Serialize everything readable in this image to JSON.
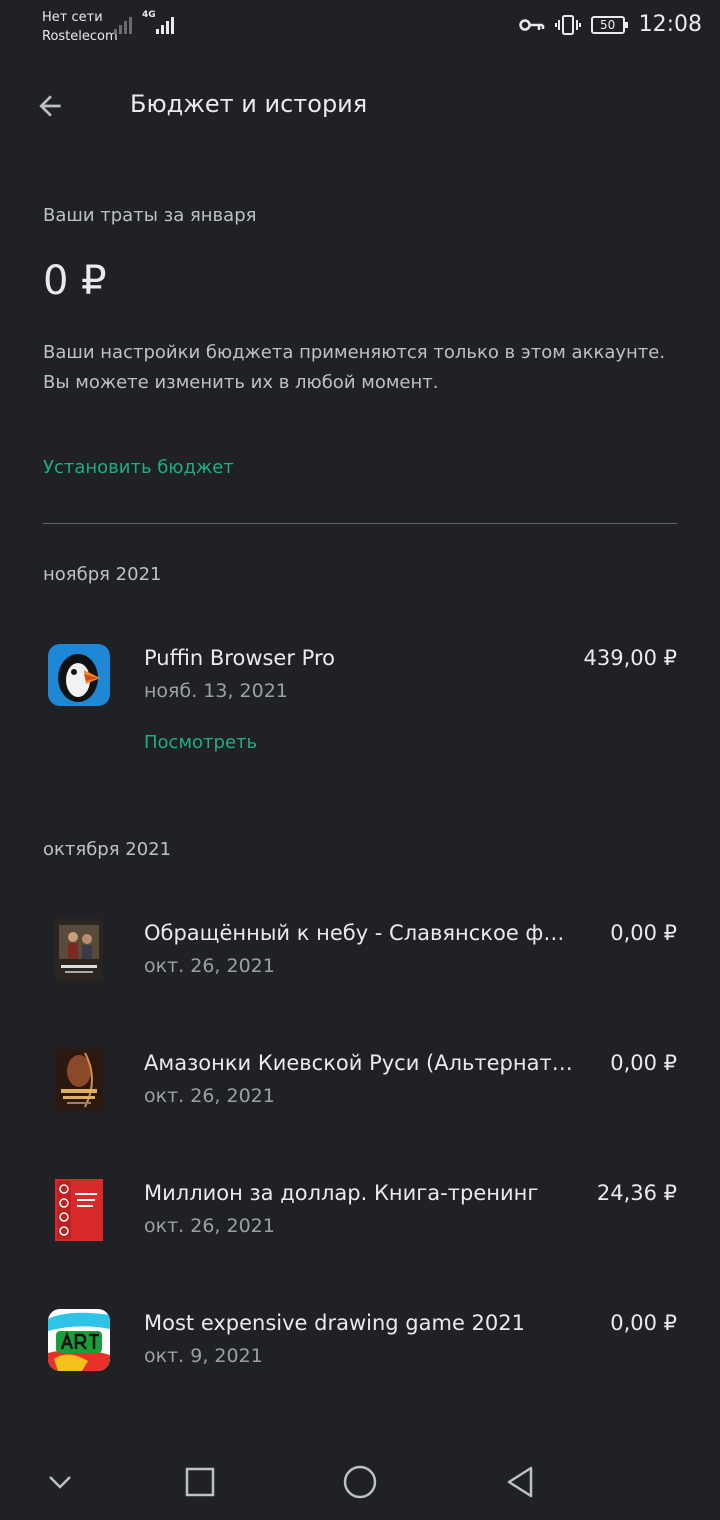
{
  "status_bar": {
    "carrier_line1": "Нет сети",
    "carrier_line2": "Rostelecom",
    "network_type": "4G",
    "battery": "50",
    "time": "12:08"
  },
  "app_bar": {
    "title": "Бюджет и история"
  },
  "budget": {
    "label": "Ваши траты за января",
    "amount": "0 ₽",
    "description": "Ваши настройки бюджета применяются только в этом аккаунте. Вы можете изменить их в любой момент.",
    "set_budget_label": "Установить бюджет"
  },
  "history": {
    "nov": {
      "header": "ноября 2021",
      "items": [
        {
          "title": "Puffin Browser Pro",
          "date": "нояб. 13, 2021",
          "price": "439,00 ₽",
          "icon": "puffin-app-icon",
          "action": "Посмотреть"
        }
      ]
    },
    "oct": {
      "header": "октября 2021",
      "items": [
        {
          "title": "Обращённый к небу - Славянское фэ…",
          "date": "окт. 26, 2021",
          "price": "0,00 ₽",
          "icon": "book-cover-icon"
        },
        {
          "title": "Амазонки Киевской Руси (Альтернати…",
          "date": "окт. 26, 2021",
          "price": "0,00 ₽",
          "icon": "book-cover-icon"
        },
        {
          "title": "Миллион за доллар. Книга-тренинг",
          "date": "окт. 26, 2021",
          "price": "24,36 ₽",
          "icon": "book-cover-icon"
        },
        {
          "title": "Most expensive drawing game 2021",
          "date": "окт. 9, 2021",
          "price": "0,00 ₽",
          "icon": "art-game-icon"
        }
      ]
    }
  },
  "colors": {
    "background": "#202124",
    "accent": "#1fae82",
    "text_primary": "#e8eaed",
    "text_secondary": "#9aa0a6"
  }
}
